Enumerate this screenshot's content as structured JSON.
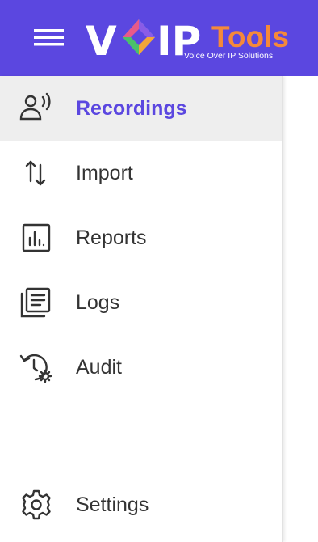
{
  "header": {
    "menu_icon": "hamburger-menu-icon",
    "logo": {
      "text_voip": "VOIP",
      "text_tools": "Tools",
      "tagline": "Voice Over IP Solutions",
      "colors": {
        "voip": "#ffffff",
        "tools": "#f5893a",
        "tagline": "#ffffff"
      }
    }
  },
  "sidebar": {
    "items": [
      {
        "label": "Recordings",
        "icon": "recordings-icon",
        "active": true
      },
      {
        "label": "Import",
        "icon": "import-icon",
        "active": false
      },
      {
        "label": "Reports",
        "icon": "reports-icon",
        "active": false
      },
      {
        "label": "Logs",
        "icon": "logs-icon",
        "active": false
      },
      {
        "label": "Audit",
        "icon": "audit-icon",
        "active": false
      }
    ],
    "footer_items": [
      {
        "label": "Settings",
        "icon": "settings-icon",
        "active": false
      }
    ]
  },
  "colors": {
    "header_bg": "#5b47e0",
    "accent": "#5b47e0",
    "active_item_bg": "#eeeeee",
    "text": "#333333"
  }
}
